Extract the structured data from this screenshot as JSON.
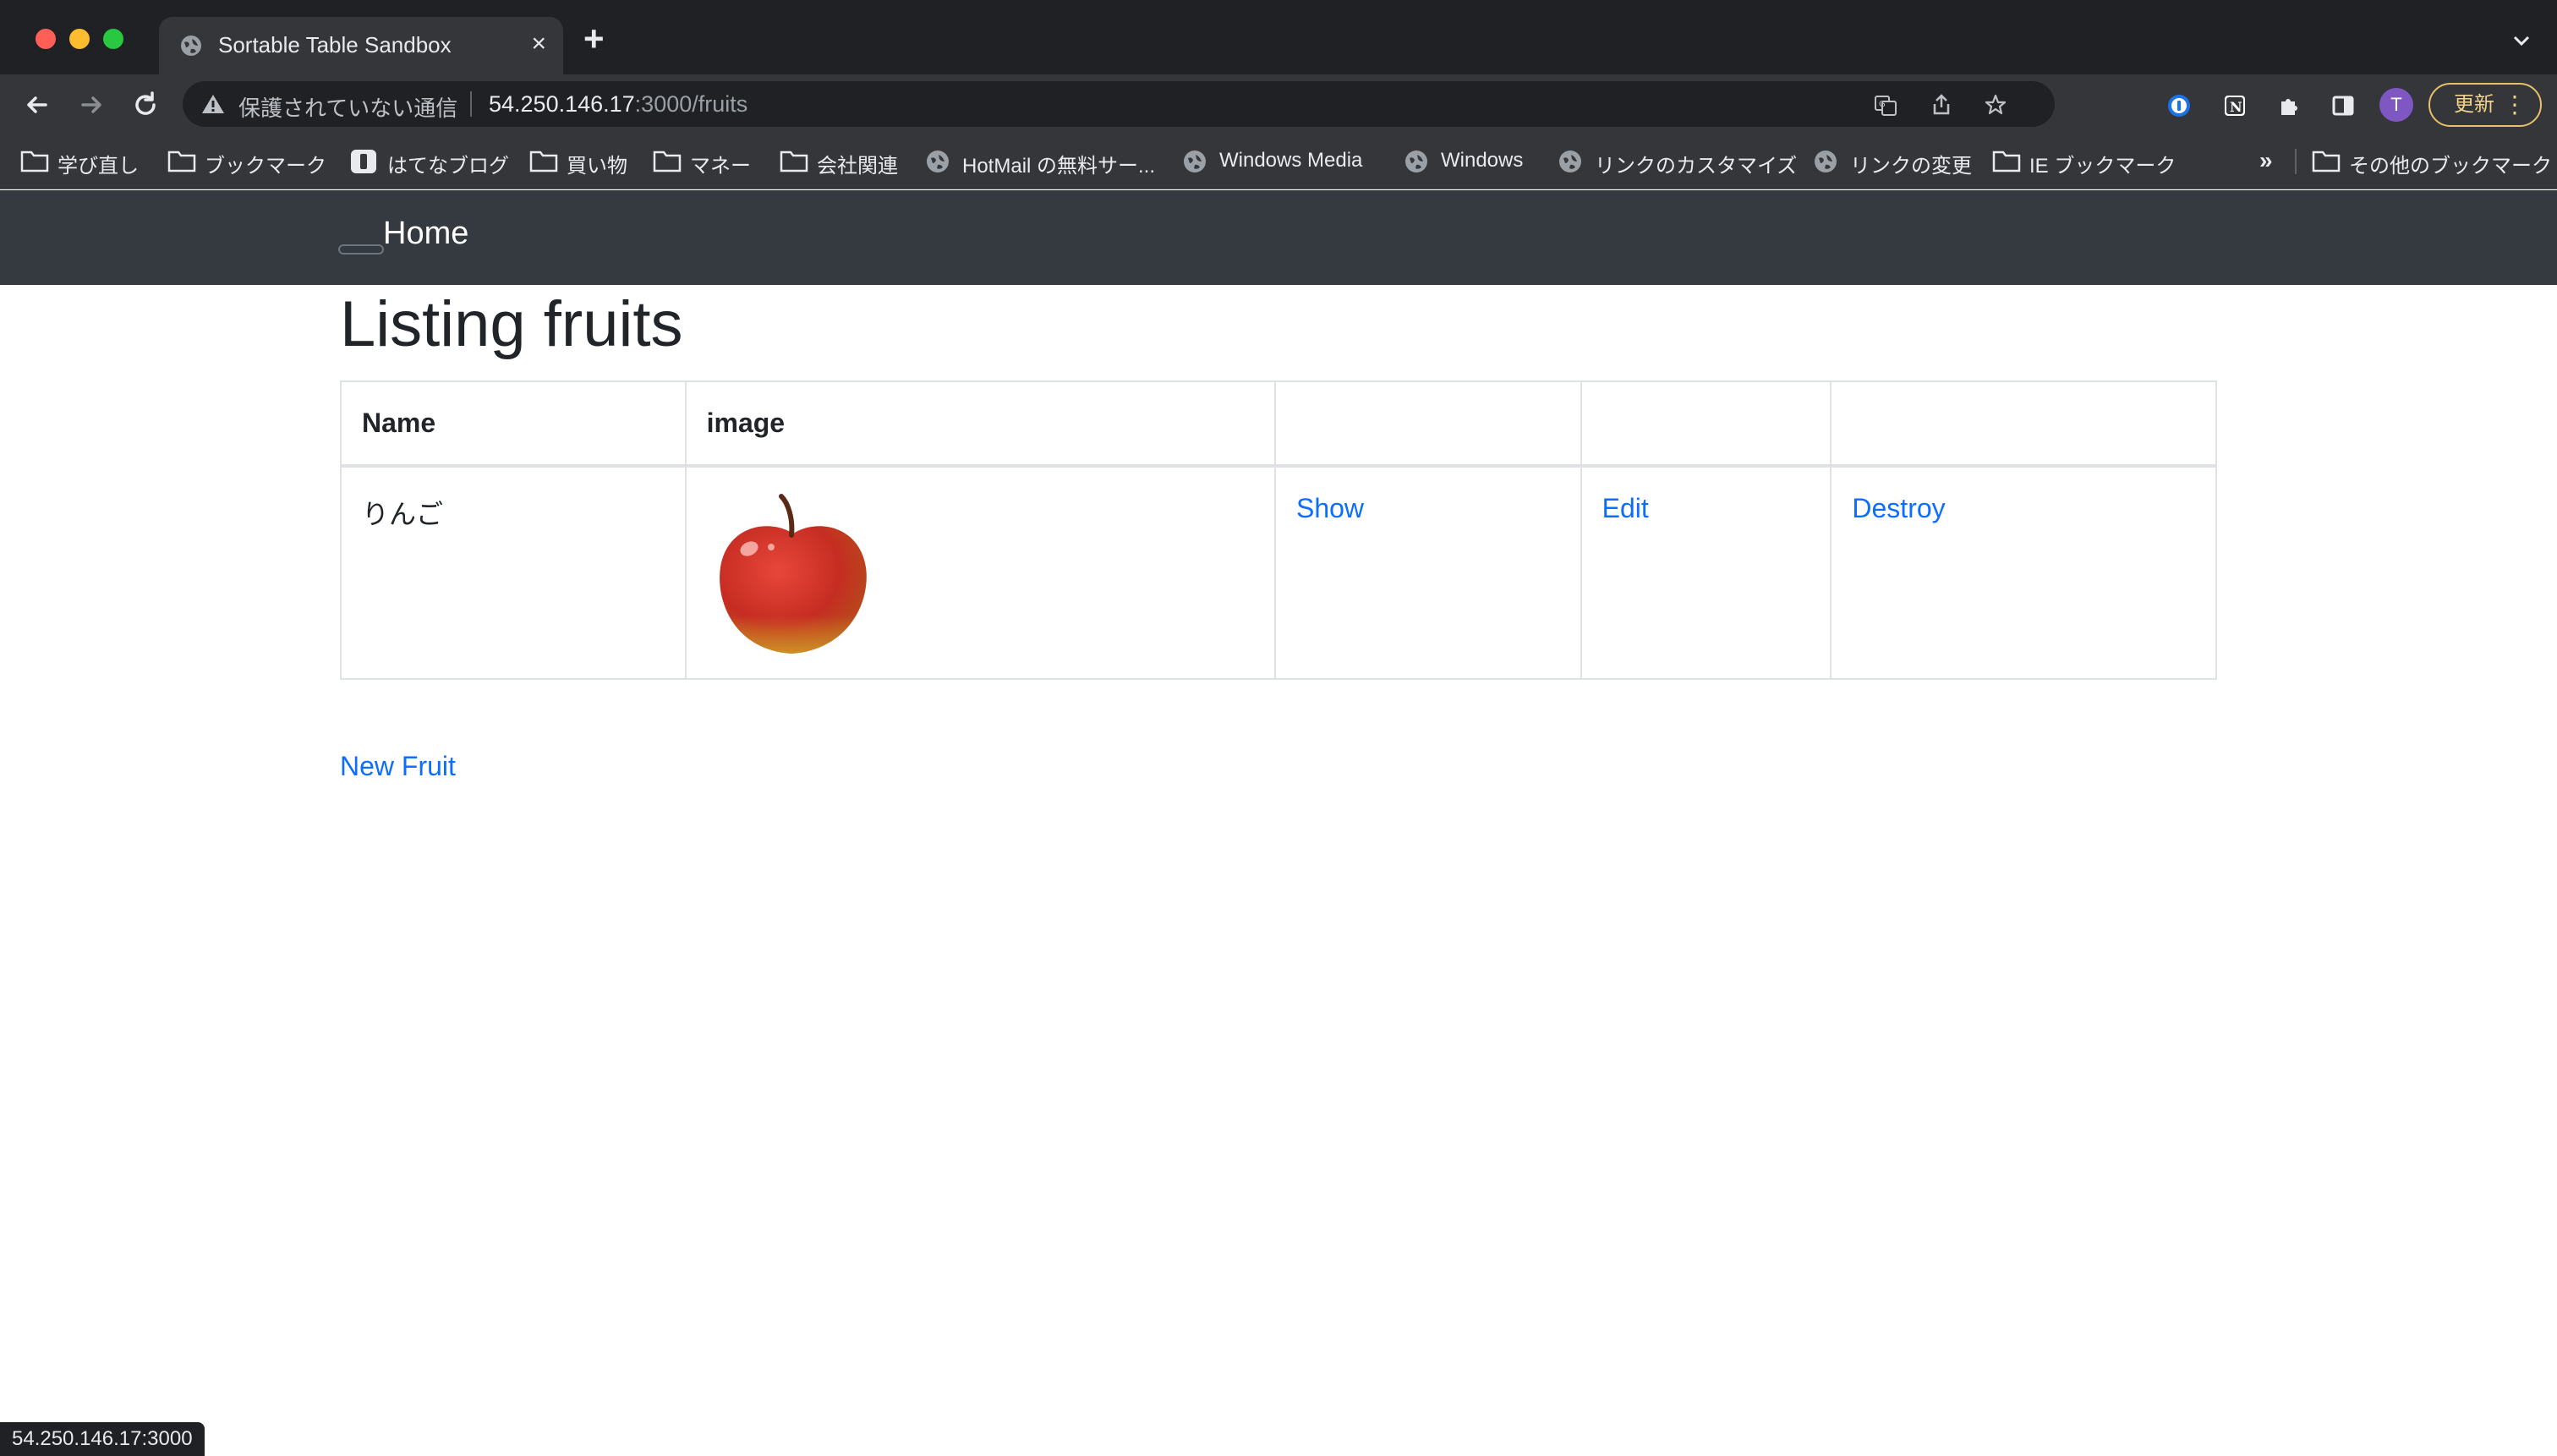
{
  "browser": {
    "tab_title": "Sortable Table Sandbox",
    "tab_close": "×",
    "new_tab": "+",
    "address": {
      "security_label": "保護されていない通信",
      "host": "54.250.146.17",
      "path": ":3000/fruits"
    },
    "avatar_letter": "T",
    "update_label": "更新",
    "update_menu": "⋮",
    "bookmarks": [
      {
        "label": "学び直し",
        "icon": "folder-icon"
      },
      {
        "label": "ブックマーク",
        "icon": "folder-icon"
      },
      {
        "label": "はてなブログ",
        "icon": "hatena-icon"
      },
      {
        "label": "買い物",
        "icon": "folder-icon"
      },
      {
        "label": "マネー",
        "icon": "folder-icon"
      },
      {
        "label": "会社関連",
        "icon": "folder-icon"
      },
      {
        "label": "HotMail の無料サー...",
        "icon": "globe-icon"
      },
      {
        "label": "Windows Media",
        "icon": "globe-icon"
      },
      {
        "label": "Windows",
        "icon": "globe-icon"
      },
      {
        "label": "リンクのカスタマイズ",
        "icon": "globe-icon"
      },
      {
        "label": "リンクの変更",
        "icon": "globe-icon"
      },
      {
        "label": "IE ブックマーク",
        "icon": "folder-icon"
      }
    ],
    "bookmarks_overflow": "»",
    "other_bookmarks": "その他のブックマーク",
    "status_url": "54.250.146.17:3000"
  },
  "page": {
    "nav_brand": "Home",
    "title": "Listing fruits",
    "table": {
      "headers": [
        "Name",
        "image",
        "",
        "",
        ""
      ],
      "rows": [
        {
          "name": "りんご",
          "image": "apple-image",
          "show": "Show",
          "edit": "Edit",
          "destroy": "Destroy"
        }
      ]
    },
    "new_fruit_link": "New Fruit"
  },
  "colors": {
    "link": "#0d6efd",
    "navbar": "#343a40",
    "chrome_dark": "#202124",
    "chrome_toolbar": "#35363a"
  }
}
